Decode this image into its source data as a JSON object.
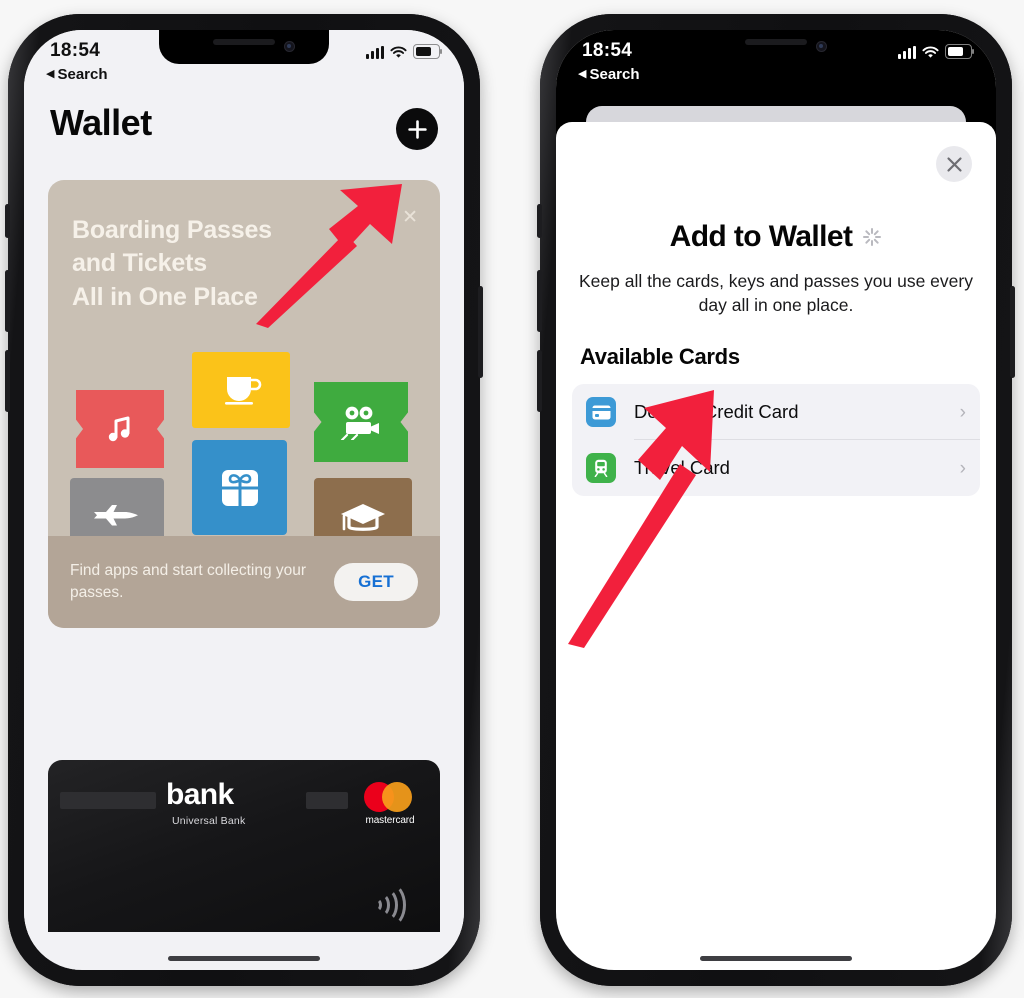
{
  "page": {
    "background": "#f7f7f7",
    "accent_arrow_color": "#f2203c"
  },
  "phones": [
    {
      "id": "left",
      "status_bar": {
        "time": "18:54",
        "back_label": "Search",
        "back_icon": "triangle-left-icon",
        "signal_icon": "cellular-signal-icon",
        "wifi_icon": "wifi-icon",
        "battery_icon": "battery-icon",
        "style": "dark-on-light"
      },
      "screen": {
        "title": "Wallet",
        "add_button_icon": "plus-icon",
        "promo_card": {
          "close_icon": "close-x-icon",
          "heading_lines": [
            "Boarding Passes",
            "and Tickets",
            "All in One Place"
          ],
          "tiles": [
            {
              "name": "music-ticket-tile",
              "icon": "music-note-icon",
              "color": "#e8595a"
            },
            {
              "name": "coffee-tile",
              "icon": "coffee-cup-icon",
              "color": "#fbc319"
            },
            {
              "name": "movie-ticket-tile",
              "icon": "film-camera-icon",
              "color": "#3fab3f"
            },
            {
              "name": "boarding-pass-tile",
              "icon": "airplane-icon",
              "color": "#8c8c8e"
            },
            {
              "name": "gift-card-tile",
              "icon": "gift-box-icon",
              "color": "#3590ca"
            },
            {
              "name": "student-id-tile",
              "icon": "graduation-cap-icon",
              "color": "#8d6e4d"
            }
          ],
          "footer_text": "Find apps and start collecting your passes.",
          "get_label": "GET",
          "get_color": "#1670d4",
          "bg_top": "#c9c0b4",
          "bg_bottom": "#b3a597"
        },
        "bank_card": {
          "brand": "bank",
          "sub_brand": "Universal Bank",
          "network": "mastercard",
          "network_icon": "mastercard-logo",
          "contactless_icon": "nfc-contactless-icon",
          "background": "#121214"
        },
        "home_indicator": "home-indicator"
      },
      "annotation_arrow": {
        "name": "arrow-to-add-button",
        "points_to": "plus-button",
        "color": "#f2203c"
      }
    },
    {
      "id": "right",
      "status_bar": {
        "time": "18:54",
        "back_label": "Search",
        "back_icon": "triangle-left-icon",
        "signal_icon": "cellular-signal-icon",
        "wifi_icon": "wifi-icon",
        "battery_icon": "battery-icon",
        "style": "light-on-dark"
      },
      "screen": {
        "sheet": {
          "close_icon": "close-x-icon",
          "title": "Add to Wallet",
          "loading_icon": "activity-spinner-icon",
          "subtitle": "Keep all the cards, keys and passes you use every day all in one place.",
          "section_title": "Available Cards",
          "rows": [
            {
              "label": "Debit or Credit Card",
              "icon": "credit-card-icon",
              "icon_color": "#3d9ad6",
              "chevron": "›"
            },
            {
              "label": "Travel Card",
              "icon": "train-icon",
              "icon_color": "#3fb24a",
              "chevron": "›"
            }
          ]
        },
        "home_indicator": "home-indicator"
      },
      "annotation_arrow": {
        "name": "arrow-to-debit-or-credit-card-row",
        "points_to": "debit-or-credit-card-row",
        "color": "#f2203c"
      }
    }
  ]
}
